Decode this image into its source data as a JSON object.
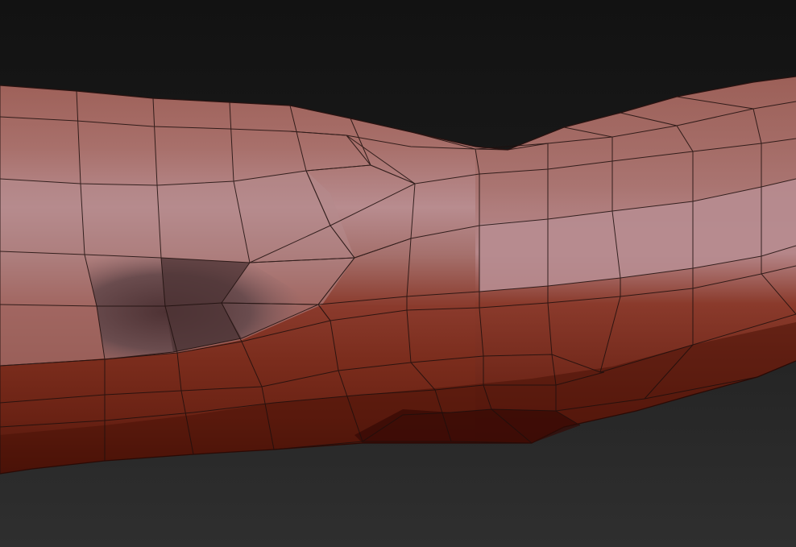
{
  "viewport": {
    "background_top": "#121212",
    "background_bottom": "#2f2f2f"
  },
  "mesh": {
    "wire_color": "#1e0f0d",
    "highlight_color": "#b07e80",
    "mid_color": "#9a5b52",
    "shadow_color": "#6a2416",
    "dark_color": "#3f0d06",
    "selected_color": "#5e4446"
  }
}
